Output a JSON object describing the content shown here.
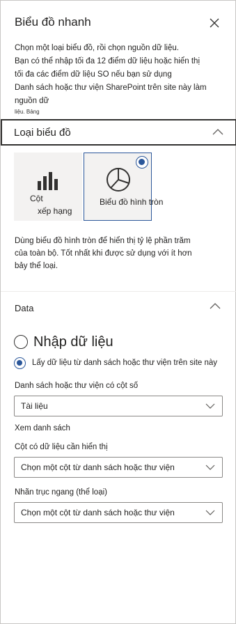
{
  "panel": {
    "title": "Biểu đồ nhanh",
    "close_icon": "close-icon"
  },
  "intro": {
    "line1": "Chọn một loại biểu đồ, rồi chọn nguồn dữ liệu.",
    "line2": "Bạn có thể nhập tối đa 12 điểm dữ liệu hoặc hiển thị",
    "line3": "tối đa các điểm dữ liệu SO nếu bạn sử dụng",
    "line4": "Danh sách hoặc thư viện SharePoint trên site này làm nguồn dữ",
    "line5": "liệu. Bảng"
  },
  "chart_type_section": {
    "label": "Loại biểu đồ",
    "tiles": [
      {
        "icon": "bar-chart-icon",
        "label_line1": "Cột",
        "label_line2": "xếp hạng",
        "selected": false
      },
      {
        "icon": "pie-chart-icon",
        "label": "Biểu đồ hình tròn",
        "selected": true
      }
    ],
    "description": "Dùng biểu đồ hình tròn để hiển thị tỷ lệ phần trăm của toàn bộ. Tốt nhất khi được sử dụng với ít hơn bảy thể loại."
  },
  "data_section": {
    "label": "Data",
    "options": [
      {
        "label": "Nhập dữ liệu",
        "selected": false
      },
      {
        "label": "Lấy dữ liệu từ danh sách hoặc thư viện trên site này",
        "selected": true
      }
    ],
    "list_field": {
      "label": "Danh sách hoặc thư viện có cột số",
      "value": "Tài liệu"
    },
    "view_list_link": "Xem danh sách",
    "column_field": {
      "label": "Cột có dữ liệu cần hiển thị",
      "value": "Chọn một cột từ danh sách hoặc thư viện"
    },
    "axis_field": {
      "label": "Nhãn trục ngang (thể loại)",
      "value": "Chọn một cột từ danh sách hoặc thư viện"
    }
  },
  "colors": {
    "accent": "#2b579a",
    "tile_bg": "#f3f2f1",
    "border": "#8a8886"
  }
}
